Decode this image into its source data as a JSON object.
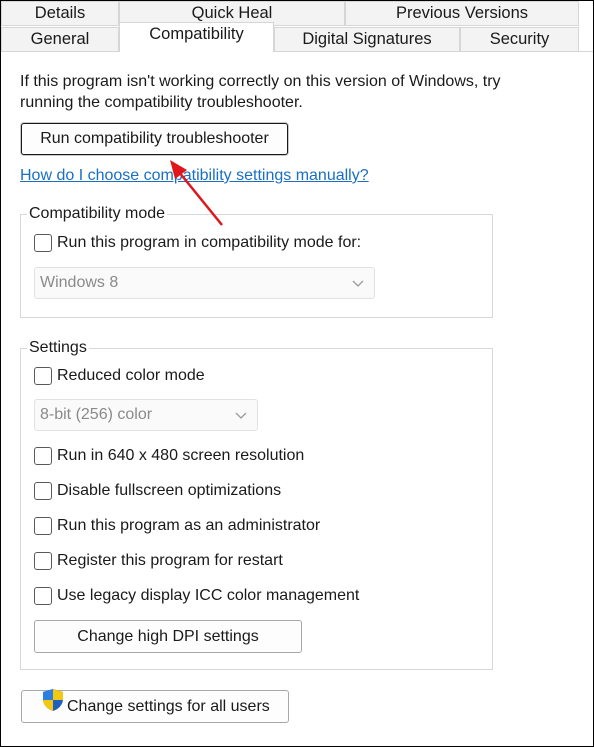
{
  "tabs_row1": [
    "Details",
    "Quick Heal",
    "Previous Versions"
  ],
  "tabs_row2": [
    "General",
    "Compatibility",
    "Digital Signatures",
    "Security"
  ],
  "intro_text": "If this program isn't working correctly on this version of Windows, try running the compatibility troubleshooter.",
  "troubleshooter_button": "Run compatibility troubleshooter",
  "help_link": "How do I choose compatibility settings manually?",
  "compat_mode": {
    "title": "Compatibility mode",
    "checkbox_label": "Run this program in compatibility mode for:",
    "checked": false,
    "dropdown_value": "Windows 8"
  },
  "settings": {
    "title": "Settings",
    "reduced_color": {
      "label": "Reduced color mode",
      "checked": false
    },
    "color_dropdown_value": "8-bit (256) color",
    "options": [
      {
        "label": "Run in 640 x 480 screen resolution",
        "checked": false
      },
      {
        "label": "Disable fullscreen optimizations",
        "checked": false
      },
      {
        "label": "Run this program as an administrator",
        "checked": false
      },
      {
        "label": "Register this program for restart",
        "checked": false
      },
      {
        "label": "Use legacy display ICC color management",
        "checked": false
      }
    ],
    "dpi_button": "Change high DPI settings"
  },
  "all_users_button": "Change settings for all users",
  "icons": {
    "shield": "uac-shield-icon",
    "chevron": "chevron-down-icon"
  },
  "colors": {
    "link": "#1a6fc4",
    "annotation_arrow": "#e0161b"
  }
}
